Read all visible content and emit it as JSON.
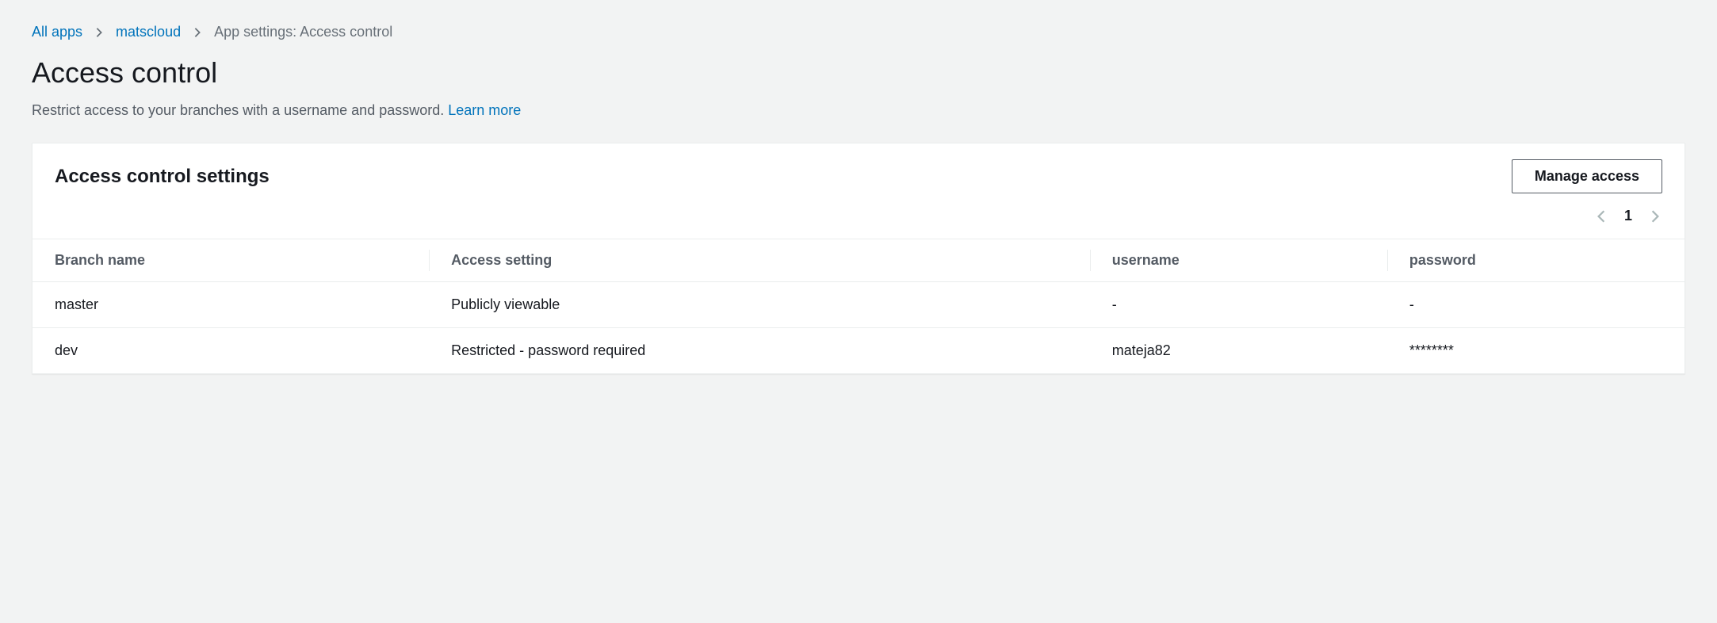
{
  "breadcrumb": {
    "root": "All apps",
    "app": "matscloud",
    "current": "App settings: Access control"
  },
  "header": {
    "title": "Access control",
    "subtitle_text": "Restrict access to your branches with a username and password. ",
    "learn_more": "Learn more"
  },
  "panel": {
    "title": "Access control settings",
    "manage_button": "Manage access",
    "page_number": "1"
  },
  "table": {
    "columns": {
      "branch": "Branch name",
      "access": "Access setting",
      "username": "username",
      "password": "password"
    },
    "rows": [
      {
        "branch": "master",
        "access": "Publicly viewable",
        "username": "-",
        "password": "-"
      },
      {
        "branch": "dev",
        "access": "Restricted - password required",
        "username": "mateja82",
        "password": "********"
      }
    ]
  }
}
